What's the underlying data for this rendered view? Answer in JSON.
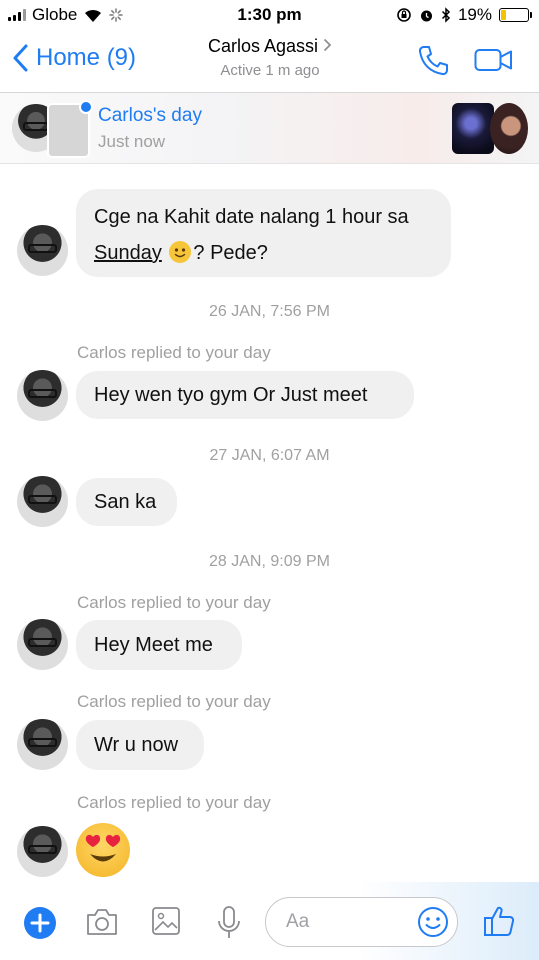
{
  "status_bar": {
    "carrier": "Globe",
    "time": "1:30 pm",
    "battery": "19%",
    "battery_level": 0.19
  },
  "nav": {
    "back_label": "Home (9)",
    "contact_name": "Carlos Agassi",
    "contact_status": "Active 1 m ago"
  },
  "story": {
    "title": "Carlos's day",
    "time": "Just now"
  },
  "messages": [
    {
      "text_part1": "Cge na Kahit date nalang 1 hour sa",
      "underlined": "Sunday",
      "text_part2": "? Pede?"
    },
    {
      "timestamp": "26 JAN, 7:56 PM"
    },
    {
      "reply_label": "Carlos replied to your day",
      "text": "Hey wen tyo gym Or Just meet"
    },
    {
      "timestamp": "27 JAN, 6:07 AM"
    },
    {
      "text": "San ka"
    },
    {
      "timestamp": "28 JAN, 9:09 PM"
    },
    {
      "reply_label": "Carlos replied to your day",
      "text": "Hey Meet me"
    },
    {
      "reply_label": "Carlos replied to your day",
      "text": "Wr u now"
    },
    {
      "reply_label": "Carlos replied to your day",
      "emoji": "heart-eyes-emoji"
    }
  ],
  "composer": {
    "placeholder": "Aa"
  },
  "colors": {
    "accent": "#1f7cf2",
    "bubble": "#f0f0f0",
    "meta_text": "#a0a0a0",
    "emoji": "#f7c53a",
    "heart": "#e8233f"
  }
}
